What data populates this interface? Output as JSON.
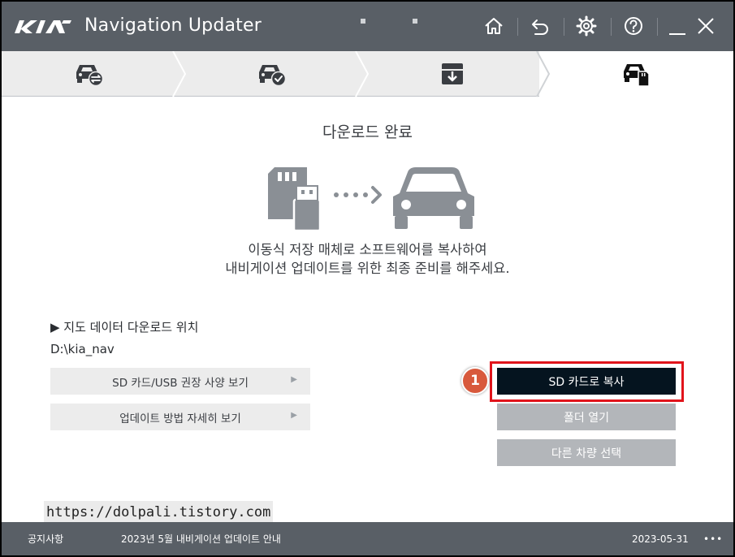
{
  "window": {
    "app_title": "Navigation Updater",
    "brand_logo_text": "KIA"
  },
  "steps": [
    {
      "icon": "car-sync-icon",
      "state": "done"
    },
    {
      "icon": "car-check-icon",
      "state": "done"
    },
    {
      "icon": "download-box-icon",
      "state": "done"
    },
    {
      "icon": "car-sdcard-icon",
      "state": "active"
    }
  ],
  "main": {
    "heading": "다운로드 완료",
    "description_line1": "이동식 저장 매체로 소프트웨어를 복사하여",
    "description_line2": "내비게이션 업데이트를 위한 최종 준비를 해주세요.",
    "download_location_label": "▶ 지도 데이터 다운로드 위치",
    "download_location_path": "D:\\kia_nav",
    "sd_usb_spec_label": "SD 카드/USB 권장 사양 보기",
    "update_guide_label": "업데이트 방법 자세히 보기",
    "copy_to_sd_label": "SD 카드로 복사",
    "open_folder_label": "폴더 열기",
    "select_other_vehicle_label": "다른 차량 선택",
    "step_badge": "1",
    "watermark": "https://dolpali.tistory.com"
  },
  "footer": {
    "notice_label": "공지사항",
    "notice_text": "2023년 5월 내비게이션 업데이트 안내",
    "notice_date": "2023-05-31",
    "more_label": "•••"
  },
  "colors": {
    "titlebar": "#595f66",
    "primary_button": "#05141f",
    "secondary_button": "#b3b6ba",
    "highlight_frame": "#e1141b",
    "badge": "#d8593c"
  }
}
